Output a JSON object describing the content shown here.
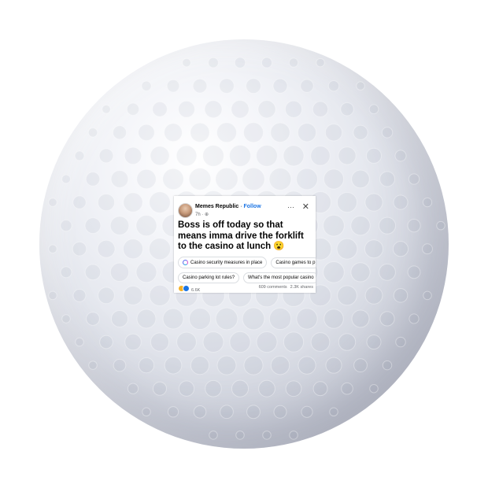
{
  "post": {
    "author": "Memes Republic",
    "separator": " · ",
    "follow_label": "Follow",
    "meta": "7h · ⊕",
    "more_glyph": "···",
    "close_glyph": "✕",
    "text": "Boss is off today so that means imma drive the forklift to the casino at lunch 😮",
    "suggestions_row1": [
      "Casino security measures in place",
      "Casino games to p"
    ],
    "suggestions_row2": [
      "Casino parking lot rules?",
      "What's the most popular casino"
    ],
    "reaction_count": "6.6K",
    "comments": "609 comments",
    "shares": "2.3K shares"
  },
  "icons": {
    "avatar": "profile-avatar",
    "more": "more-options-icon",
    "close": "close-icon",
    "ai_suggestion": "meta-ai-icon",
    "haha_reaction": "haha-reaction-icon",
    "like_reaction": "like-reaction-icon"
  },
  "colors": {
    "follow": "#1b74e4",
    "ball": "#e4e6ee"
  }
}
